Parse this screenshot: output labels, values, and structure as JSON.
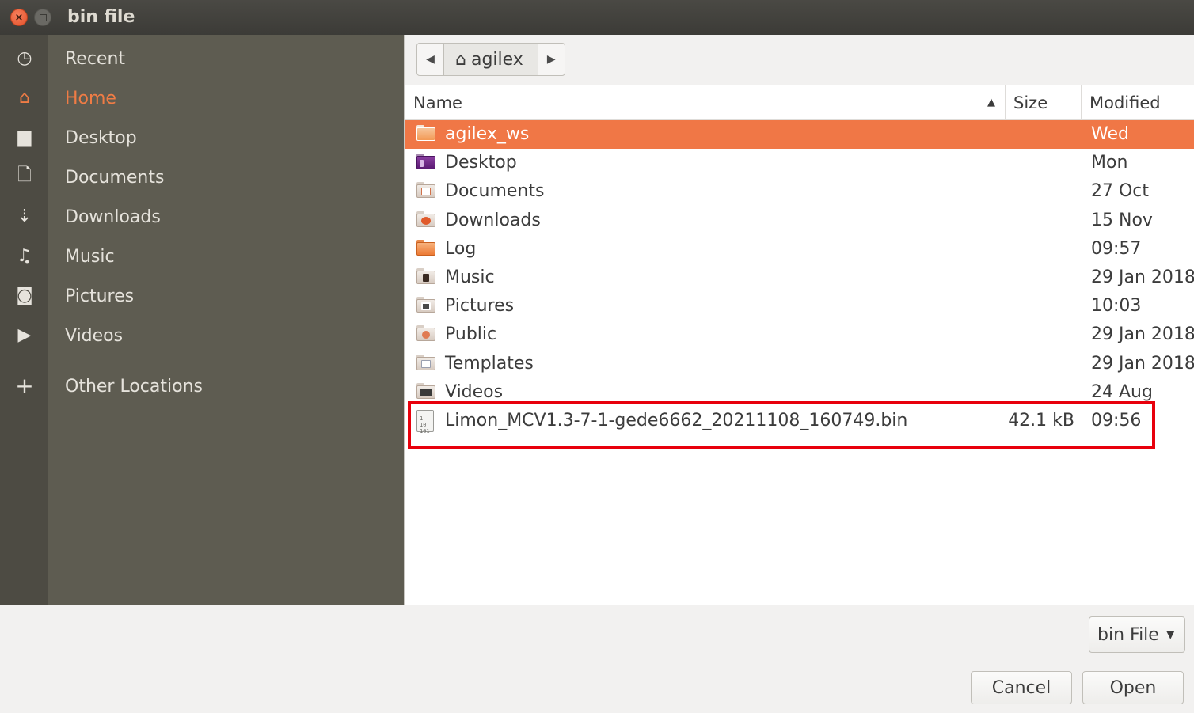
{
  "window": {
    "title": "bin file",
    "close_glyph": "×"
  },
  "sidebar": {
    "items": [
      {
        "label": "Recent",
        "icon": "clock-icon",
        "glyph": "◷",
        "active": false
      },
      {
        "label": "Home",
        "icon": "home-icon",
        "glyph": "⌂",
        "active": true
      },
      {
        "label": "Desktop",
        "icon": "folder-icon",
        "glyph": "▆",
        "active": false
      },
      {
        "label": "Documents",
        "icon": "document-icon",
        "glyph": "🗋",
        "active": false
      },
      {
        "label": "Downloads",
        "icon": "download-icon",
        "glyph": "⇣",
        "active": false
      },
      {
        "label": "Music",
        "icon": "music-icon",
        "glyph": "♫",
        "active": false
      },
      {
        "label": "Pictures",
        "icon": "camera-icon",
        "glyph": "◙",
        "active": false
      },
      {
        "label": "Videos",
        "icon": "video-icon",
        "glyph": "▶",
        "active": false
      },
      {
        "label": "Other Locations",
        "icon": "plus-icon",
        "glyph": "+",
        "active": false
      }
    ]
  },
  "pathbar": {
    "back_glyph": "◀",
    "forward_glyph": "▶",
    "home_glyph": "⌂",
    "current": "agilex"
  },
  "columns": {
    "name": "Name",
    "size": "Size",
    "modified": "Modified",
    "sort_glyph": "▲"
  },
  "files": [
    {
      "name": "agilex_ws",
      "size": "",
      "modified": "Wed",
      "type": "folder",
      "selected": true
    },
    {
      "name": "Desktop",
      "size": "",
      "modified": "Mon",
      "type": "desktop-folder",
      "selected": false
    },
    {
      "name": "Documents",
      "size": "",
      "modified": "27 Oct",
      "type": "documents-folder",
      "selected": false
    },
    {
      "name": "Downloads",
      "size": "",
      "modified": "15 Nov",
      "type": "downloads-folder",
      "selected": false
    },
    {
      "name": "Log",
      "size": "",
      "modified": "09:57",
      "type": "folder",
      "selected": false
    },
    {
      "name": "Music",
      "size": "",
      "modified": "29 Jan 2018",
      "type": "music-folder",
      "selected": false
    },
    {
      "name": "Pictures",
      "size": "",
      "modified": "10:03",
      "type": "pictures-folder",
      "selected": false
    },
    {
      "name": "Public",
      "size": "",
      "modified": "29 Jan 2018",
      "type": "public-folder",
      "selected": false
    },
    {
      "name": "Templates",
      "size": "",
      "modified": "29 Jan 2018",
      "type": "templates-folder",
      "selected": false
    },
    {
      "name": "Videos",
      "size": "",
      "modified": "24 Aug",
      "type": "videos-folder",
      "selected": false
    },
    {
      "name": "Limon_MCV1.3-7-1-gede6662_20211108_160749.bin",
      "size": "42.1 kB",
      "modified": "09:56",
      "type": "binary-file",
      "selected": false
    }
  ],
  "file_icon_text": "1\n10\n101",
  "footer": {
    "filter_label": "bin File",
    "filter_caret": "▼",
    "cancel_label": "Cancel",
    "open_label": "Open"
  },
  "colors": {
    "accent": "#f07746",
    "highlight_box": "#e8000c",
    "sidebar_bg": "#5e5c51",
    "titlebar_bg": "#3c3b37"
  }
}
